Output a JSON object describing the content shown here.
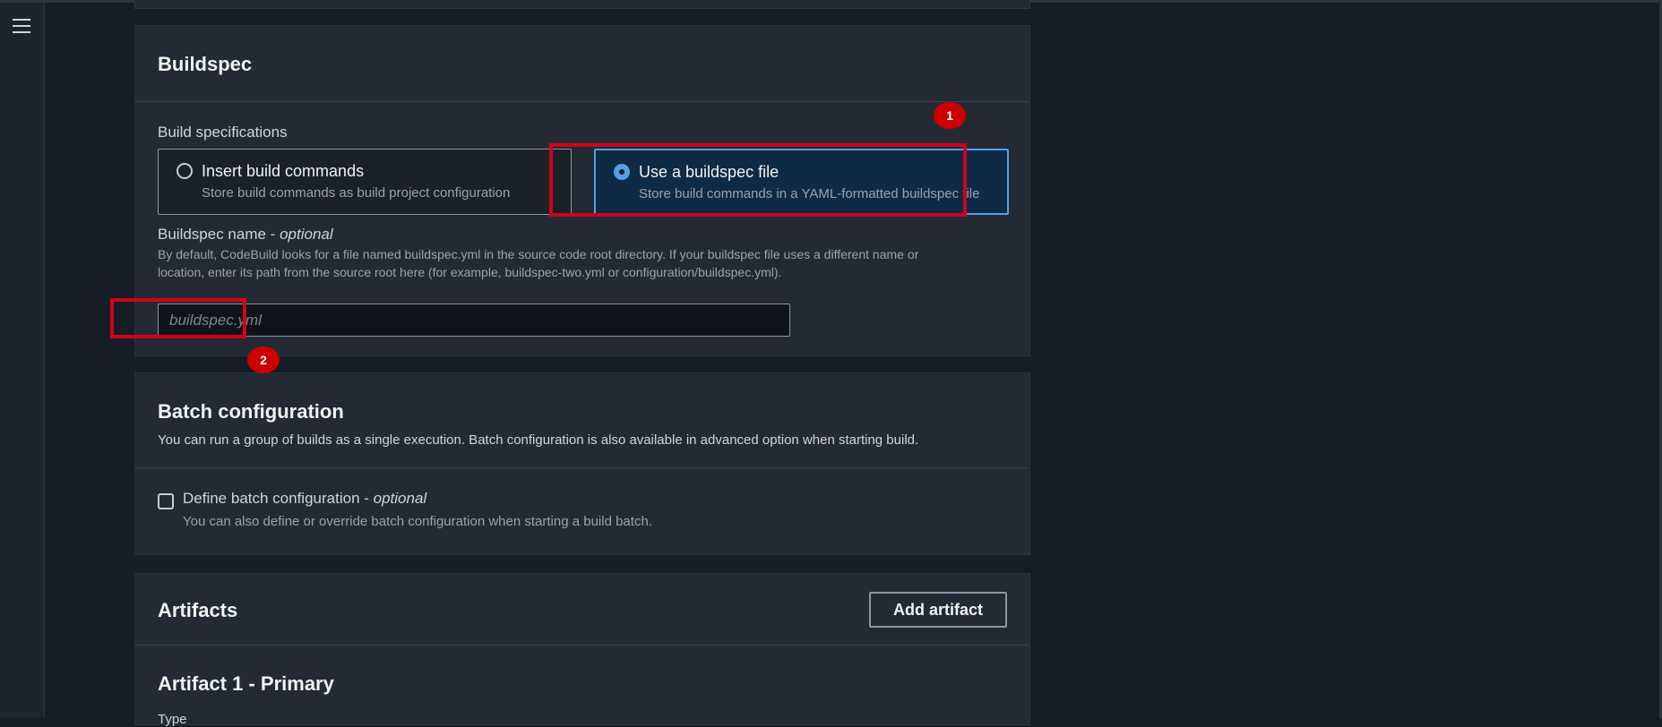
{
  "buildspec": {
    "title": "Buildspec",
    "spec_label": "Build specifications",
    "options": [
      {
        "title": "Insert build commands",
        "desc": "Store build commands as build project configuration",
        "selected": false
      },
      {
        "title": "Use a buildspec file",
        "desc": "Store build commands in a YAML-formatted buildspec file",
        "selected": true
      }
    ],
    "name_label": "Buildspec name - ",
    "name_optional": "optional",
    "name_desc_1": "By default, CodeBuild looks for a file named buildspec.yml in the source code root directory. If your buildspec file uses a different name or",
    "name_desc_2": "location, enter its path from the source root here (for example, buildspec-two.yml or configuration/buildspec.yml).",
    "name_placeholder": "buildspec.yml",
    "name_value": ""
  },
  "batch": {
    "title": "Batch configuration",
    "subtitle": "You can run a group of builds as a single execution. Batch configuration is also available in advanced option when starting build.",
    "define_label": "Define batch configuration - ",
    "define_optional": "optional",
    "define_desc": "You can also define or override batch configuration when starting a build batch."
  },
  "artifacts": {
    "title": "Artifacts",
    "add_button": "Add artifact",
    "artifact1_title": "Artifact 1 - Primary",
    "type_label": "Type"
  },
  "annotations": {
    "badge1": "1",
    "badge2": "2",
    "highlight_color": "#d0021b",
    "badge_color": "#cc0000"
  },
  "colors": {
    "background": "#161d26",
    "panel": "#232a33",
    "accent": "#539fe5"
  }
}
